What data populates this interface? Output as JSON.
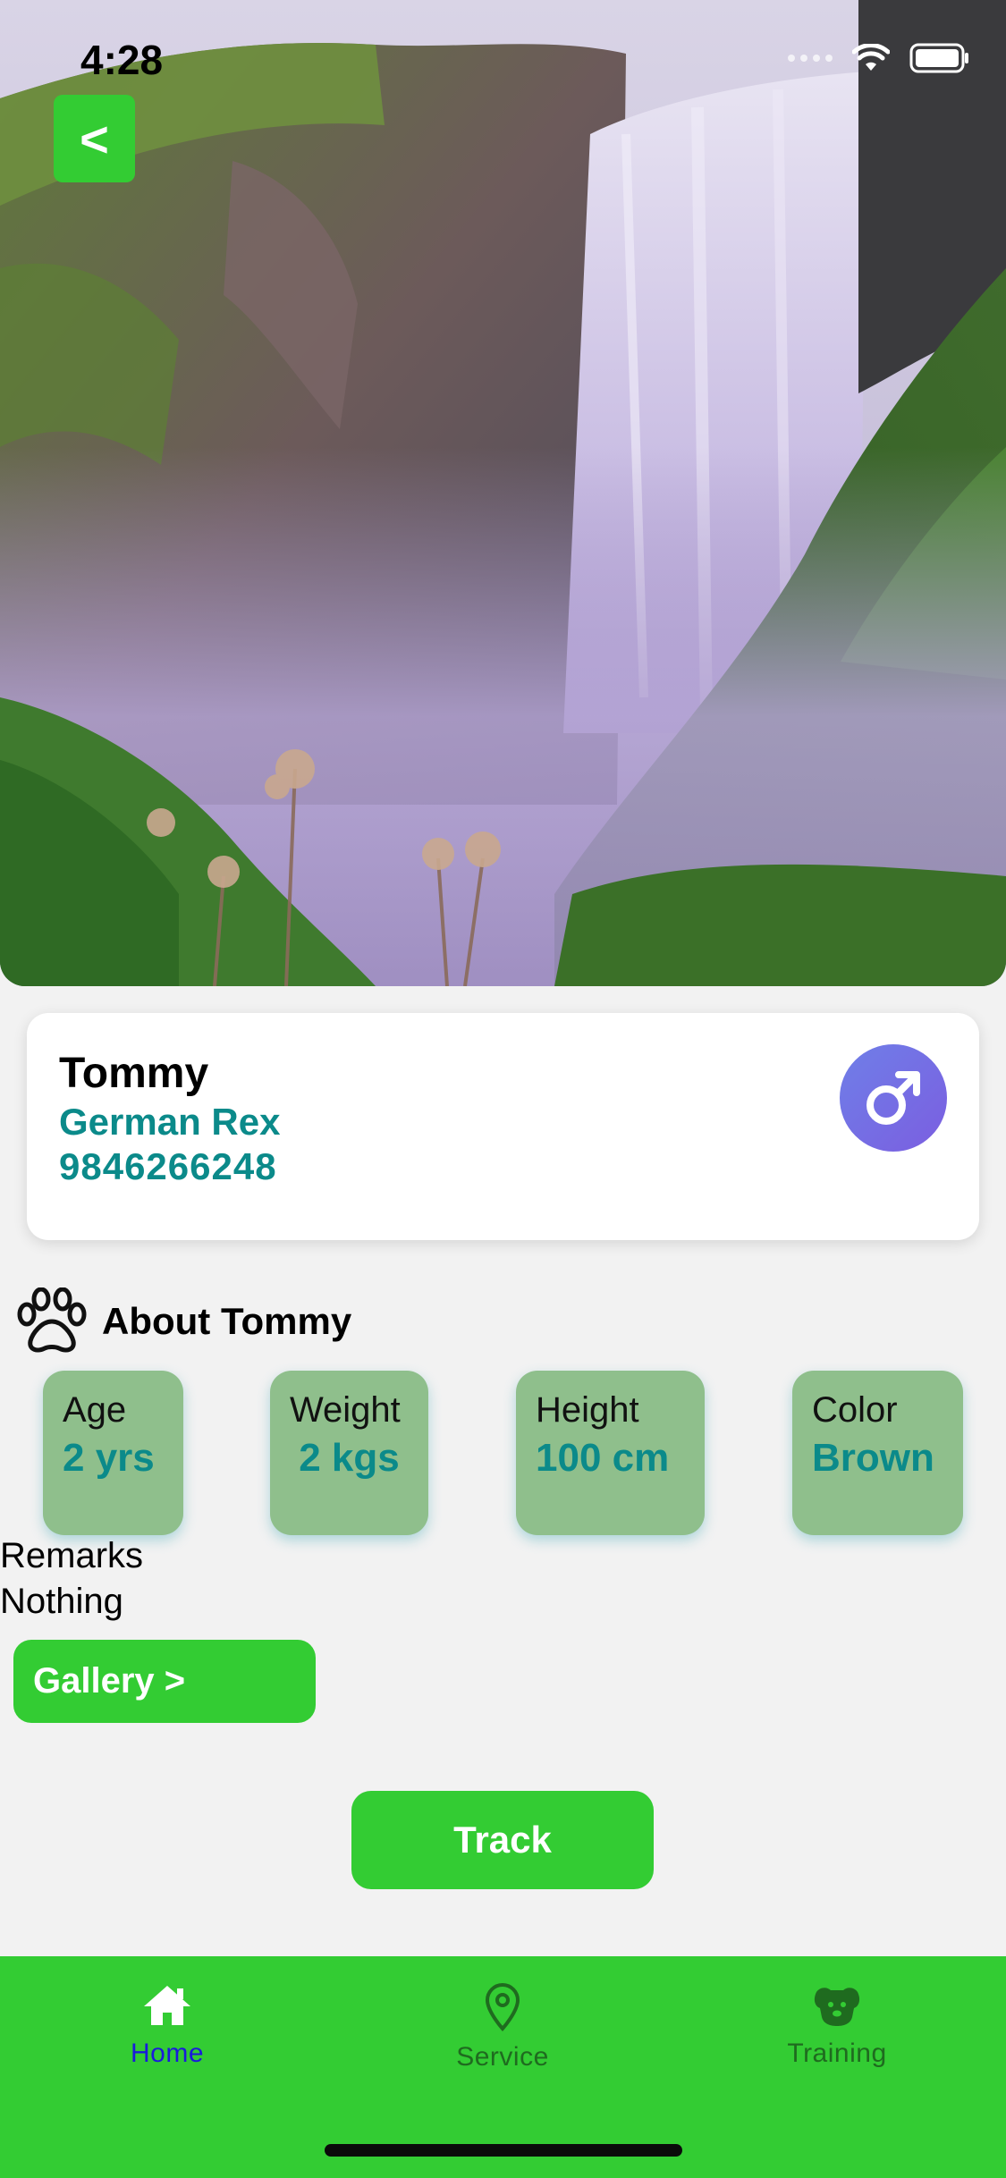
{
  "status_bar": {
    "time": "4:28"
  },
  "back_button": {
    "label": "<"
  },
  "pet": {
    "name": "Tommy",
    "breed": "German Rex",
    "phone": "9846266248",
    "gender_icon": "male-symbol-icon"
  },
  "about": {
    "title": "About Tommy",
    "icon": "paw-icon",
    "stats": [
      {
        "label": "Age",
        "value": "2 yrs"
      },
      {
        "label": "Weight",
        "value": "2 kgs"
      },
      {
        "label": "Height",
        "value": "100 cm"
      },
      {
        "label": "Color",
        "value": "Brown"
      }
    ]
  },
  "remarks": {
    "label": "Remarks",
    "value": "Nothing"
  },
  "buttons": {
    "gallery": "Gallery >",
    "track": "Track"
  },
  "nav": {
    "items": [
      {
        "label": "Home",
        "icon": "home-icon",
        "active": true
      },
      {
        "label": "Service",
        "icon": "location-pin-icon",
        "active": false
      },
      {
        "label": "Training",
        "icon": "dog-icon",
        "active": false
      }
    ]
  },
  "colors": {
    "accent_green": "#33cc33",
    "teal_text": "#0b8a8a",
    "stat_box": "#8fbf8c",
    "nav_active": "#1a1adb",
    "nav_inactive": "#1f6b1f",
    "gender_badge": "#7468e4"
  }
}
